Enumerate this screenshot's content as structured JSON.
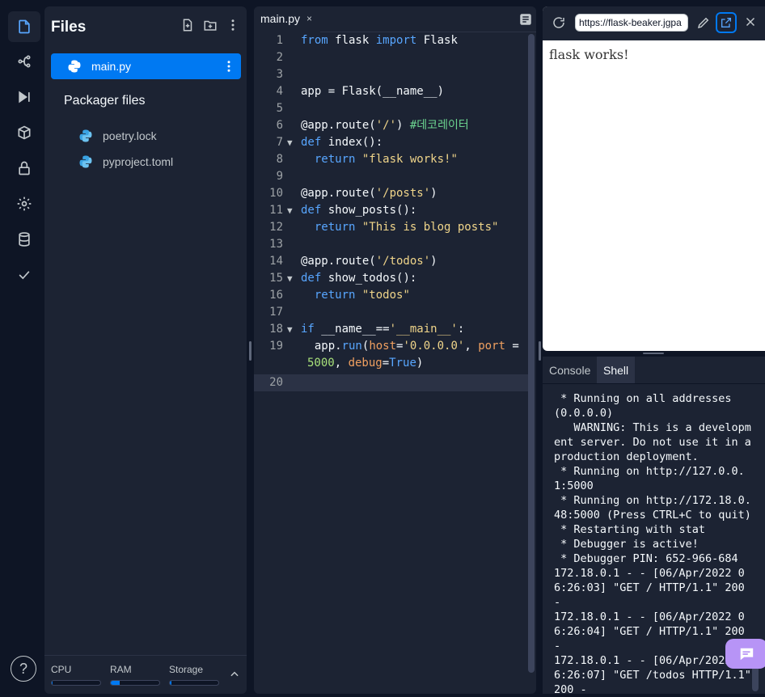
{
  "activity_bar": {
    "items": [
      {
        "icon": "files-icon"
      },
      {
        "icon": "version-control-icon"
      },
      {
        "icon": "run-icon"
      },
      {
        "icon": "packages-icon"
      },
      {
        "icon": "secrets-icon"
      },
      {
        "icon": "settings-icon"
      },
      {
        "icon": "database-icon"
      },
      {
        "icon": "tests-icon"
      }
    ],
    "help_label": "?"
  },
  "files": {
    "title": "Files",
    "selected_file": "main.py",
    "packager_title": "Packager files",
    "packager_items": [
      "poetry.lock",
      "pyproject.toml"
    ],
    "resources": {
      "cpu_label": "CPU",
      "ram_label": "RAM",
      "storage_label": "Storage",
      "cpu_fraction": 0.02,
      "ram_fraction": 0.18,
      "storage_fraction": 0.03
    }
  },
  "editor": {
    "tab_label": "main.py",
    "tab_close": "×",
    "line_numbers": [
      "1",
      "2",
      "3",
      "4",
      "5",
      "6",
      "7",
      "8",
      "9",
      "10",
      "11",
      "12",
      "13",
      "14",
      "15",
      "16",
      "17",
      "18",
      "19",
      "",
      "20"
    ],
    "fold_lines": [
      7,
      11,
      15,
      18
    ],
    "active_line": 20
  },
  "webview": {
    "url": "https://flask-beaker.jgpa",
    "body_text": "flask works!"
  },
  "console": {
    "tabs": [
      "Console",
      "Shell"
    ],
    "active_tab": "Shell",
    "output": " * Running on all addresses (0.0.0.0)\n   WARNING: This is a development server. Do not use it in a production deployment.\n * Running on http://127.0.0.1:5000\n * Running on http://172.18.0.48:5000 (Press CTRL+C to quit)\n * Restarting with stat\n * Debugger is active!\n * Debugger PIN: 652-966-684\n172.18.0.1 - - [06/Apr/2022 06:26:03] \"GET / HTTP/1.1\" 200 -\n172.18.0.1 - - [06/Apr/2022 06:26:04] \"GET / HTTP/1.1\" 200 -\n172.18.0.1 - - [06/Apr/2022 06:26:07] \"GET /todos HTTP/1.1\" 200 -\n"
  },
  "colors": {
    "accent": "#0079f2",
    "background": "#0e1525",
    "panel": "#1c2333",
    "chat_button": "#b794f6"
  }
}
